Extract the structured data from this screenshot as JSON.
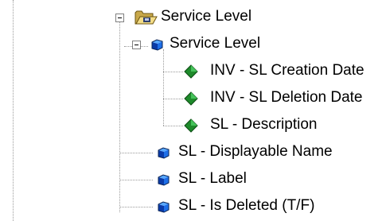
{
  "tree": {
    "folder": {
      "label": "Service Level",
      "icon": "open-folder-icon",
      "expanded": true
    },
    "class": {
      "label": "Service Level",
      "icon": "cube-icon",
      "expanded": true,
      "children": [
        {
          "label": "INV - SL Creation Date",
          "icon": "diamond-arrow-icon"
        },
        {
          "label": "INV - SL Deletion Date",
          "icon": "diamond-arrow-icon"
        },
        {
          "label": "SL - Description",
          "icon": "diamond-arrow-icon"
        }
      ]
    },
    "siblings": [
      {
        "label": "SL - Displayable Name",
        "icon": "cube-icon"
      },
      {
        "label": "SL - Label",
        "icon": "cube-icon"
      },
      {
        "label": "SL - Is Deleted (T/F)",
        "icon": "cube-icon"
      }
    ]
  }
}
